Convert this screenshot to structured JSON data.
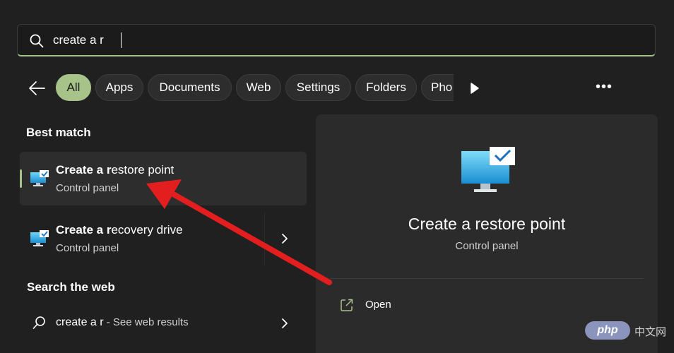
{
  "search": {
    "value": "create a r"
  },
  "filters": {
    "items": [
      "All",
      "Apps",
      "Documents",
      "Web",
      "Settings",
      "Folders",
      "Pho"
    ],
    "active": "All",
    "more_label": "•••"
  },
  "best_match": {
    "heading": "Best match",
    "results": [
      {
        "title_bold": "Create a r",
        "title_rest": "estore point",
        "subtitle": "Control panel"
      },
      {
        "title_bold": "Create a r",
        "title_rest": "ecovery drive",
        "subtitle": "Control panel"
      }
    ]
  },
  "web": {
    "heading": "Search the web",
    "query": "create a r",
    "suffix": " - See web results"
  },
  "preview": {
    "title": "Create a restore point",
    "subtitle": "Control panel",
    "open_label": "Open"
  },
  "watermark": {
    "logo": "php",
    "text": "中文网"
  },
  "colors": {
    "accent": "#a7c38a",
    "background": "#202020",
    "panel": "#2b2b2b",
    "annotation_arrow": "#e31e1e"
  },
  "icons": [
    "search-icon",
    "back-arrow-icon",
    "play-icon",
    "more-icon",
    "monitor-check-icon",
    "chevron-right-icon",
    "open-external-icon"
  ]
}
